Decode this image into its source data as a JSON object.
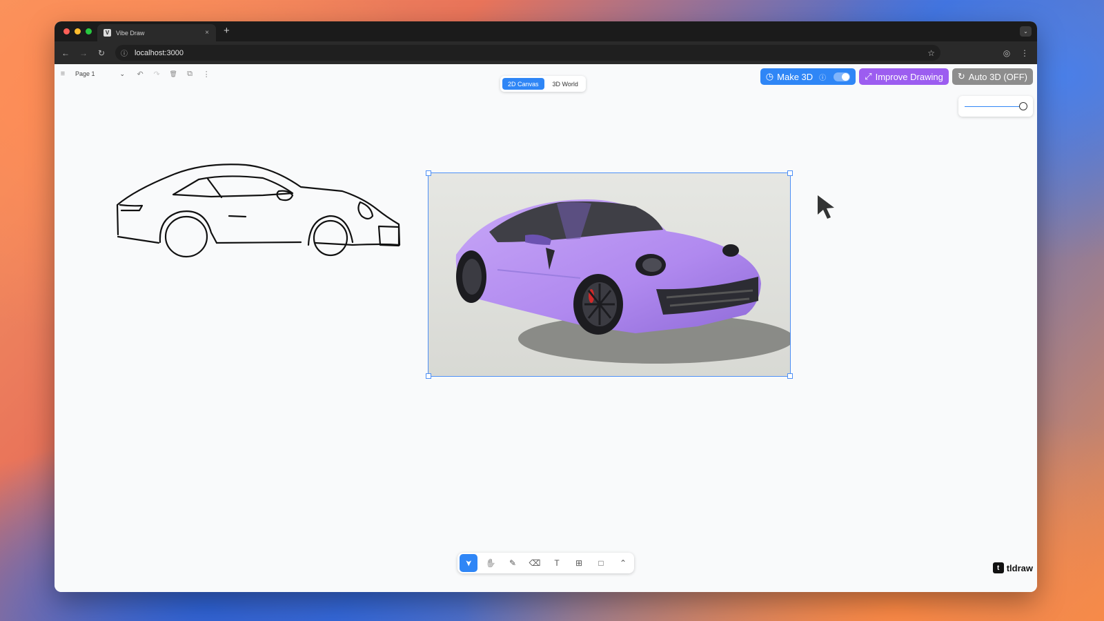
{
  "browser": {
    "tab_title": "Vibe Draw",
    "tab_favicon": "V",
    "tab_close": "×",
    "new_tab": "+",
    "window_menu": "⌄",
    "url": "localhost:3000",
    "traffic_lights": [
      "#ff5f57",
      "#febc2e",
      "#28c840"
    ],
    "nav_icons": {
      "back": "←",
      "forward": "→",
      "reload": "↻"
    },
    "site_info_icon": "ⓘ",
    "bookmark_icon": "☆",
    "profile_icon": "◎",
    "menu_icon": "⋮"
  },
  "tldraw_menu": {
    "page_label": "Page 1",
    "dropdown_icon": "⌄",
    "icons": {
      "menu": "≡",
      "undo": "↶",
      "redo": "↷",
      "delete": "🗑",
      "duplicate": "⧉",
      "more": "⋮"
    }
  },
  "view_switch": {
    "canvas_label": "2D Canvas",
    "world_label": "3D World",
    "active": "2D Canvas"
  },
  "actions": {
    "make3d": {
      "icon": "◷",
      "label": "Make 3D",
      "info": "ⓘ",
      "toggle_on": true
    },
    "improve": {
      "icon": "⤢",
      "label": "Improve Drawing"
    },
    "auto3d": {
      "icon": "↻",
      "label": "Auto 3D (OFF)"
    }
  },
  "slider": {
    "value": 1.0
  },
  "canvas": {
    "shapes": [
      "car-sketch",
      "generated-car-image"
    ],
    "selected": "generated-car-image"
  },
  "toolbar": {
    "tools": [
      {
        "name": "select",
        "icon": "➤"
      },
      {
        "name": "hand",
        "icon": "✋"
      },
      {
        "name": "draw",
        "icon": "✎"
      },
      {
        "name": "eraser",
        "icon": "⌫"
      },
      {
        "name": "text",
        "icon": "T"
      },
      {
        "name": "asset",
        "icon": "⊞"
      },
      {
        "name": "rectangle",
        "icon": "□"
      },
      {
        "name": "more",
        "icon": "⌃"
      }
    ],
    "active": "select"
  },
  "branding": {
    "mark": "t",
    "label": "tldraw"
  },
  "colors": {
    "primary": "#2f86f6",
    "purple": "#9c5df0",
    "gray": "#8d8d8d",
    "car": "#b68ef2"
  }
}
